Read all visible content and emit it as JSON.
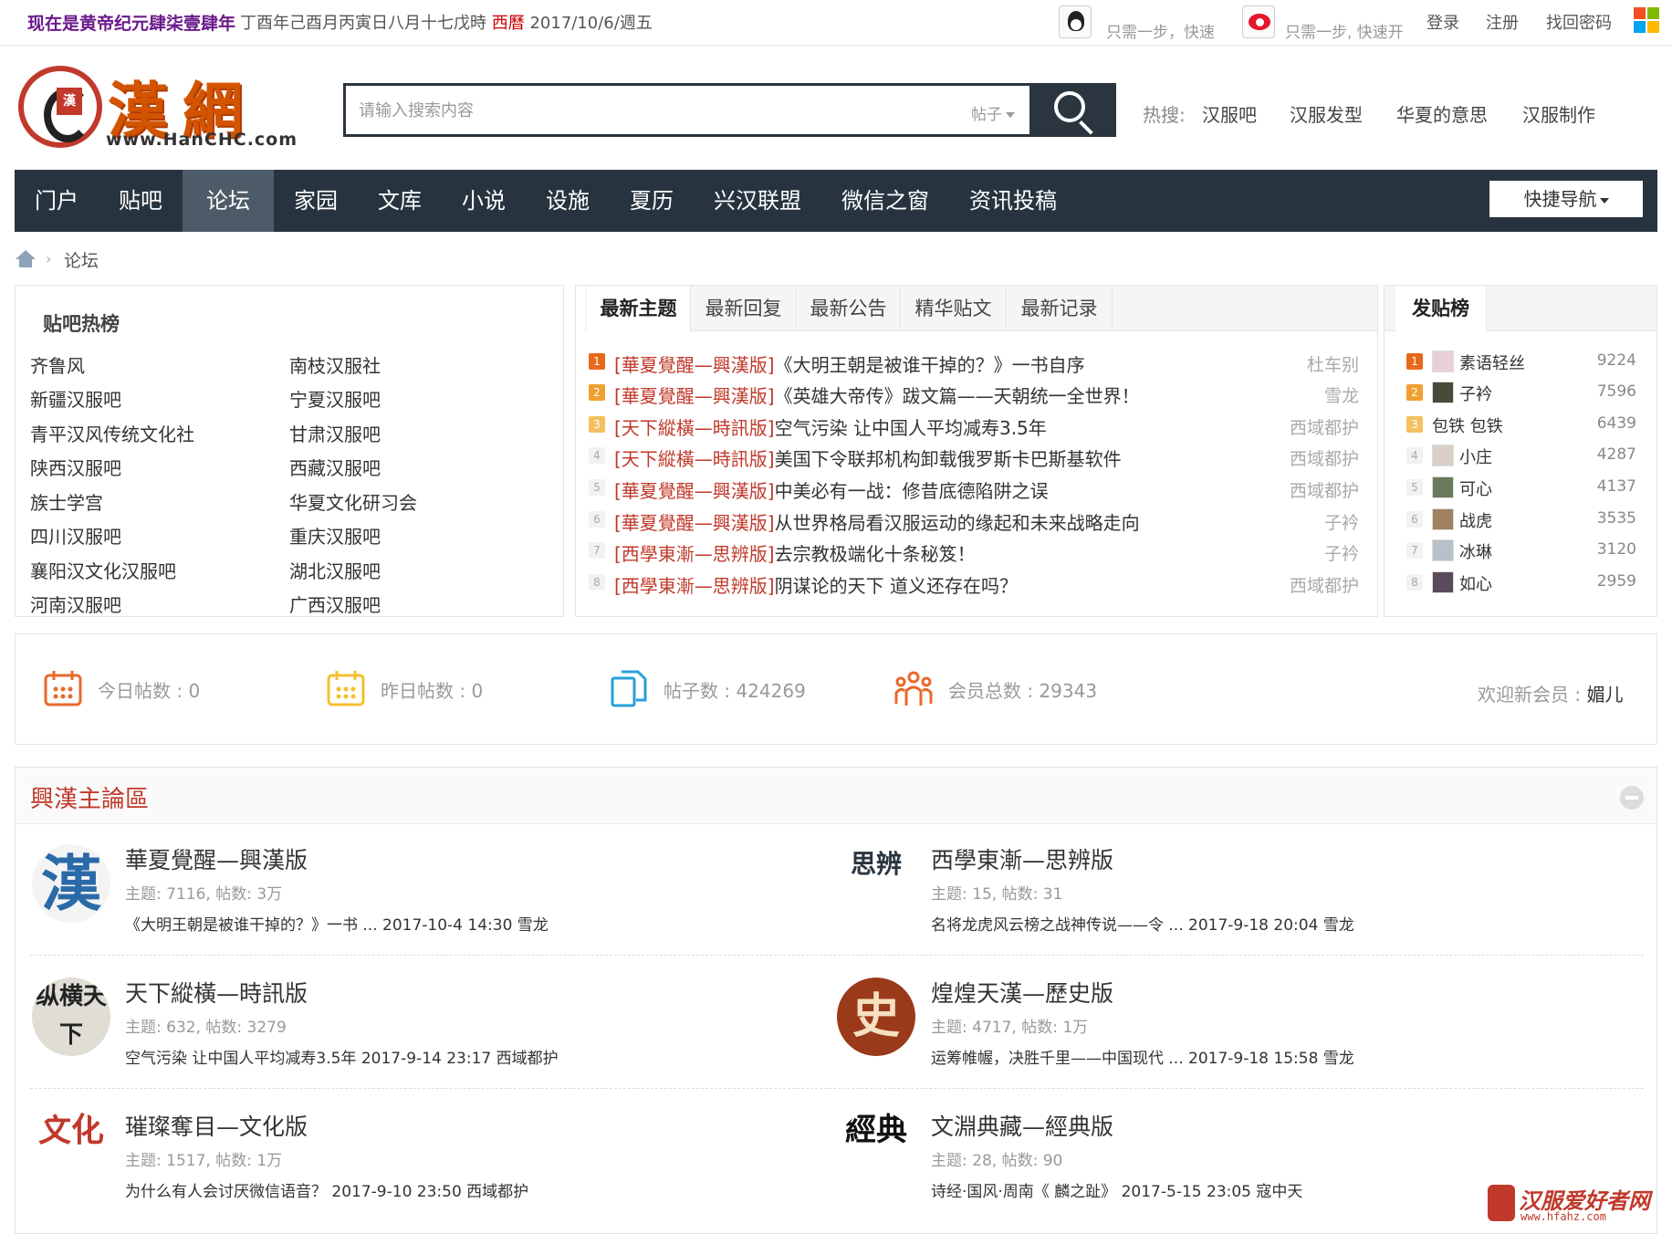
{
  "topbar": {
    "era": "现在是黄帝纪元肆柒壹肆年",
    "lunar": "丁酉年己酉月丙寅日八月十七戊時",
    "gregorian_label": "西曆",
    "gregorian_date": "2017/10/6/週五",
    "qq_text": "只需一步，快速",
    "weibo_text": "只需一步, 快速开",
    "login": "登录",
    "register": "注册",
    "recover": "找回密码"
  },
  "header": {
    "logo_glyph_1": "漢",
    "logo_glyph_2": "網",
    "logo_seal": "漢",
    "logo_url": "www.HanCHC.com",
    "search_placeholder": "请输入搜索内容",
    "search_type": "帖子",
    "hot_label": "热搜:",
    "hot_links": [
      "汉服吧",
      "汉服发型",
      "华夏的意思",
      "汉服制作"
    ]
  },
  "nav": {
    "items": [
      "门户",
      "贴吧",
      "论坛",
      "家园",
      "文库",
      "小说",
      "设施",
      "夏历",
      "兴汉联盟",
      "微信之窗",
      "资讯投稿"
    ],
    "active_index": 2,
    "quick_nav": "快捷导航"
  },
  "breadcrumb": {
    "current": "论坛"
  },
  "hotbar": {
    "title": "贴吧热榜",
    "col1": [
      "齐鲁风",
      "新疆汉服吧",
      "青平汉风传统文化社",
      "陕西汉服吧",
      "族士学宫",
      "四川汉服吧",
      "襄阳汉文化汉服吧",
      "河南汉服吧"
    ],
    "col2": [
      "南枝汉服社",
      "宁夏汉服吧",
      "甘肃汉服吧",
      "西藏汉服吧",
      "华夏文化研习会",
      "重庆汉服吧",
      "湖北汉服吧",
      "广西汉服吧"
    ]
  },
  "topics": {
    "tabs": [
      "最新主题",
      "最新回复",
      "最新公告",
      "精华贴文",
      "最新记录"
    ],
    "rows": [
      {
        "rank": "1",
        "forum": "[華夏覺醒—興漢版]",
        "title": "《大明王朝是被谁干掉的？》一书自序",
        "author": "杜车别"
      },
      {
        "rank": "2",
        "forum": "[華夏覺醒—興漢版]",
        "title": "《英雄大帝传》跋文篇——天朝统一全世界！",
        "author": "雪龙"
      },
      {
        "rank": "3",
        "forum": "[天下縱橫—時訊版]",
        "title": "空气污染 让中国人平均减寿3.5年",
        "author": "西域都护"
      },
      {
        "rank": "4",
        "forum": "[天下縱橫—時訊版]",
        "title": "美国下令联邦机构卸载俄罗斯卡巴斯基软件",
        "author": "西域都护"
      },
      {
        "rank": "5",
        "forum": "[華夏覺醒—興漢版]",
        "title": "中美必有一战：修昔底德陷阱之误",
        "author": "西域都护"
      },
      {
        "rank": "6",
        "forum": "[華夏覺醒—興漢版]",
        "title": "从世界格局看汉服运动的缘起和未来战略走向",
        "author": "子衿"
      },
      {
        "rank": "7",
        "forum": "[西學東漸—思辨版]",
        "title": "去宗教极端化十条秘笈！",
        "author": "子衿"
      },
      {
        "rank": "8",
        "forum": "[西學東漸—思辨版]",
        "title": "阴谋论的天下 道义还存在吗？",
        "author": "西域都护"
      }
    ]
  },
  "posters": {
    "title": "发贴榜",
    "rows": [
      {
        "rank": "1",
        "name": "素语轻丝",
        "count": "9224"
      },
      {
        "rank": "2",
        "name": "子衿",
        "count": "7596"
      },
      {
        "rank": "3",
        "name": "包铁 包铁",
        "count": "6439"
      },
      {
        "rank": "4",
        "name": "小庄",
        "count": "4287"
      },
      {
        "rank": "5",
        "name": "可心",
        "count": "4137"
      },
      {
        "rank": "6",
        "name": "战虎",
        "count": "3535"
      },
      {
        "rank": "7",
        "name": "冰琳",
        "count": "3120"
      },
      {
        "rank": "8",
        "name": "如心",
        "count": "2959"
      }
    ]
  },
  "stats": {
    "today": "今日帖数 : 0",
    "yesterday": "昨日帖数 : 0",
    "posts": "帖子数 : 424269",
    "members": "会员总数 : 29343",
    "welcome_label": "欢迎新会员 : ",
    "welcome_name": "媚儿"
  },
  "forums": {
    "section_title": "興漢主論區",
    "items": [
      {
        "name": "華夏覺醒—興漢版",
        "stat": "主题: 7116, 帖数: 3万",
        "last": "《大明王朝是被谁干掉的？》一书 ... 2017-10-4 14:30 雪龙",
        "logo_text": "漢"
      },
      {
        "name": "西學東漸—思辨版",
        "stat": "主题: 15, 帖数: 31",
        "last": "名将龙虎风云榜之战神传说——令 ... 2017-9-18 20:04 雪龙",
        "logo_text": "思辨"
      },
      {
        "name": "天下縱橫—時訊版",
        "stat": "主题: 632, 帖数: 3279",
        "last": "空气污染 让中国人平均减寿3.5年 2017-9-14 23:17 西域都护",
        "logo_text": "纵横天下"
      },
      {
        "name": "煌煌天漢—歷史版",
        "stat": "主题: 4717, 帖数: 1万",
        "last": "运筹帷幄，决胜千里——中国现代 ... 2017-9-18 15:58 雪龙",
        "logo_text": "史"
      },
      {
        "name": "璀璨奪目—文化版",
        "stat": "主题: 1517, 帖数: 1万",
        "last": "为什么有人会讨厌微信语音？ 2017-9-10 23:50 西域都护",
        "logo_text": "文化"
      },
      {
        "name": "文淵典藏—經典版",
        "stat": "主题: 28, 帖数: 90",
        "last": "诗经·国风·周南《 麟之趾》 2017-5-15 23:05 寇中天",
        "logo_text": "經典"
      }
    ]
  },
  "watermark": {
    "text": "汉服爱好者网",
    "url": "www.hfahz.com"
  },
  "colors": {
    "nav_bg": "#273440",
    "accent_red": "#c0392b",
    "era_purple": "#6a1a8a"
  }
}
